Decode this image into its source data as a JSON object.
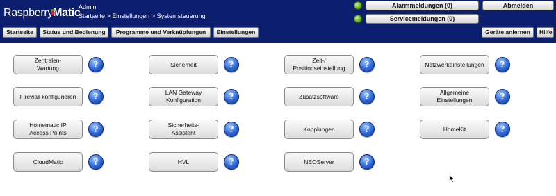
{
  "header": {
    "logo_prefix": "Raspberry",
    "logo_suffix": "Matic",
    "user": "Admin",
    "breadcrumb": "Startseite > Einstellungen > Systemsteuerung",
    "alarm_label": "Alarmmeldungen (0)",
    "service_label": "Servicemeldungen (0)",
    "logout_label": "Abmelden",
    "status_color": "#5fb31a"
  },
  "nav": {
    "startseite": "Startseite",
    "status": "Status und Bedienung",
    "programme": "Programme und Verknüpfungen",
    "einstellungen": "Einstellungen",
    "geraete": "Geräte anlernen",
    "hilfe": "Hilfe"
  },
  "help_symbol": "?",
  "tiles": [
    {
      "label": "Zentralen-\nWartung"
    },
    {
      "label": "Sicherheit"
    },
    {
      "label": "Zeit-/\nPositionseinstellung"
    },
    {
      "label": "Netzwerkeinstellungen"
    },
    {
      "label": "Firewall konfigurieren"
    },
    {
      "label": "LAN Gateway\nKonfiguration"
    },
    {
      "label": "Zusatzsoftware"
    },
    {
      "label": "Allgemeine\nEinstellungen"
    },
    {
      "label": "Homematic IP\nAccess Points"
    },
    {
      "label": "Sicherheits-\nAssistent"
    },
    {
      "label": "Kopplungen"
    },
    {
      "label": "HomeKit"
    },
    {
      "label": "CloudMatic"
    },
    {
      "label": "HVL"
    },
    {
      "label": "NEOServer"
    }
  ]
}
